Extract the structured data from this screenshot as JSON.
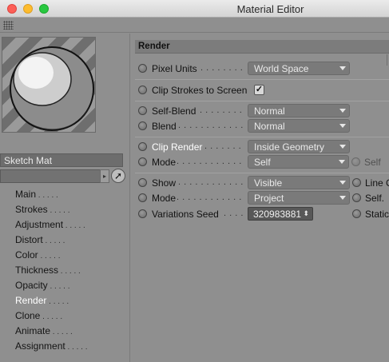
{
  "window": {
    "title": "Material Editor"
  },
  "material": {
    "name": "Sketch Mat",
    "filter_value": ""
  },
  "nav": {
    "items": [
      "Main",
      "Strokes",
      "Adjustment",
      "Distort",
      "Color",
      "Thickness",
      "Opacity",
      "Render",
      "Clone",
      "Animate",
      "Assignment"
    ],
    "active": "Render"
  },
  "section": {
    "title": "Render"
  },
  "fields": {
    "pixel_units": {
      "label": "Pixel Units",
      "value": "World Space"
    },
    "clip_strokes": {
      "label": "Clip Strokes to Screen",
      "checked": true,
      "check_glyph": "✓"
    },
    "self_blend": {
      "label": "Self-Blend",
      "value": "Normal"
    },
    "blend": {
      "label": "Blend",
      "value": "Normal"
    },
    "clip_render": {
      "label": "Clip Render",
      "value": "Inside Geometry"
    },
    "clip_mode": {
      "label": "Mode",
      "value": "Self"
    },
    "clip_self": {
      "label": "Self"
    },
    "show": {
      "label": "Show",
      "value": "Visible"
    },
    "show_mode": {
      "label": "Mode",
      "value": "Project"
    },
    "variations_seed": {
      "label": "Variations Seed",
      "value": "320983881"
    },
    "line": {
      "label": "Line C"
    },
    "self2": {
      "label": "Self."
    },
    "static": {
      "label": "Static"
    }
  },
  "icons": {
    "picker": "arrow-pointer-icon",
    "filter_arrow": "chevron-right-icon",
    "spin": "stepper-icon"
  },
  "colors": {
    "titlebar": "#dddddd",
    "panel": "#8f8f8f",
    "highlight_text": "#ffffff"
  }
}
